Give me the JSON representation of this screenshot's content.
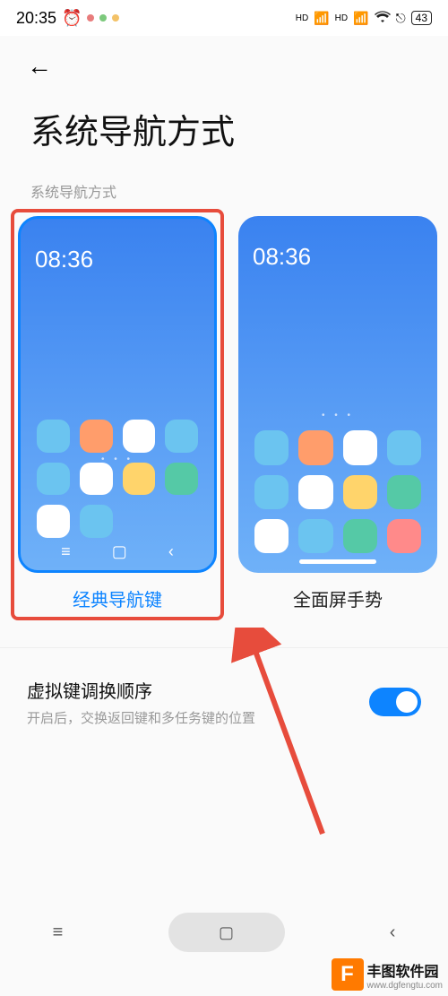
{
  "status": {
    "time": "20:35",
    "alarm_icon": "alarm",
    "dots": [
      "#e87c7c",
      "#7cc97c",
      "#f3c268"
    ],
    "hd1": "HD",
    "hd2": "HD",
    "wifi": "wifi",
    "extra": "⎋",
    "battery": "43"
  },
  "back": "←",
  "page_title": "系统导航方式",
  "section_label": "系统导航方式",
  "options": [
    {
      "key": "classic",
      "label": "经典导航键",
      "preview_time": "08:36",
      "selected": true,
      "nav": {
        "menu": "≡",
        "home": "▢",
        "back": "‹"
      },
      "dots": "• • •",
      "icons": [
        "#6bc4f0",
        "#ff9d6b",
        "#ffffff",
        "#6bc4f0",
        "#6bc4f0",
        "#ffffff",
        "#ffd46b",
        "#55c9a6",
        "#ffffff",
        "#6bc4f0"
      ]
    },
    {
      "key": "gesture",
      "label": "全面屏手势",
      "preview_time": "08:36",
      "selected": false,
      "dots": "• • •",
      "icons": [
        "#6bc4f0",
        "#ff9d6b",
        "#ffffff",
        "#6bc4f0",
        "#6bc4f0",
        "#ffffff",
        "#ffd46b",
        "#55c9a6",
        "#ffffff",
        "#6bc4f0",
        "#55c9a6",
        "#ff8a8a"
      ]
    }
  ],
  "setting": {
    "title": "虚拟键调换顺序",
    "subtitle": "开启后，交换返回键和多任务键的位置",
    "enabled": true
  },
  "system_nav": {
    "menu": "≡",
    "home": "▢",
    "back": "‹"
  },
  "watermark": {
    "f": "F",
    "name": "丰图软件园",
    "url": "www.dgfengtu.com"
  }
}
